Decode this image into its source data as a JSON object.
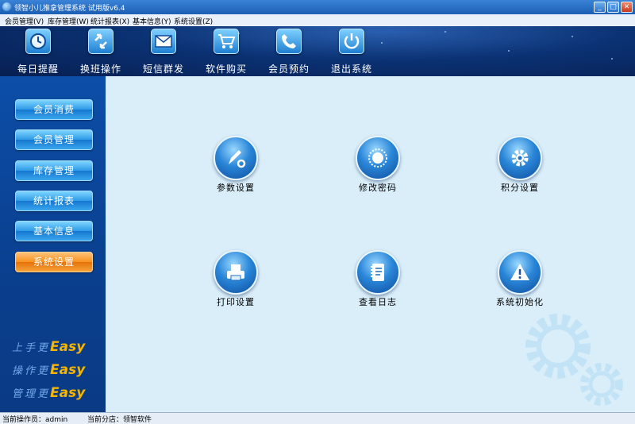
{
  "window": {
    "title": "领智小儿推拿管理系统 试用版v6.4",
    "min_label": "_",
    "max_label": "□",
    "close_label": "✕"
  },
  "menu": [
    {
      "label": "会员管理(V)"
    },
    {
      "label": "库存管理(W)"
    },
    {
      "label": "统计报表(X)"
    },
    {
      "label": "基本信息(Y)"
    },
    {
      "label": "系统设置(Z)"
    }
  ],
  "toolbar": [
    {
      "label": "每日提醒",
      "icon": "clock-icon"
    },
    {
      "label": "换班操作",
      "icon": "swap-arrows-icon"
    },
    {
      "label": "短信群发",
      "icon": "envelope-icon"
    },
    {
      "label": "软件购买",
      "icon": "shopping-cart-icon"
    },
    {
      "label": "会员预约",
      "icon": "phone-icon"
    },
    {
      "label": "退出系统",
      "icon": "power-icon"
    }
  ],
  "sidebar": {
    "items": [
      {
        "label": "会员消费",
        "active": false
      },
      {
        "label": "会员管理",
        "active": false
      },
      {
        "label": "库存管理",
        "active": false
      },
      {
        "label": "统计报表",
        "active": false
      },
      {
        "label": "基本信息",
        "active": false
      },
      {
        "label": "系统设置",
        "active": true
      }
    ],
    "slogans": [
      {
        "text": "上手更",
        "accent": "Easy"
      },
      {
        "text": "操作更",
        "accent": "Easy"
      },
      {
        "text": "管理更",
        "accent": "Easy"
      }
    ]
  },
  "main": {
    "functions": [
      {
        "label": "参数设置",
        "icon": "pen-gear-icon"
      },
      {
        "label": "修改密码",
        "icon": "dial-icon"
      },
      {
        "label": "积分设置",
        "icon": "gear-icon"
      },
      {
        "label": "打印设置",
        "icon": "printer-icon"
      },
      {
        "label": "查看日志",
        "icon": "notebook-icon"
      },
      {
        "label": "系统初始化",
        "icon": "warning-icon"
      }
    ]
  },
  "status": {
    "operator": "当前操作员：admin",
    "branch": "当前分店：领智软件"
  },
  "colors": {
    "accent_orange": "#f8921e",
    "nav_blue": "#2d9ae6",
    "main_bg": "#daeef9",
    "slogan_yellow": "#f4b400"
  }
}
